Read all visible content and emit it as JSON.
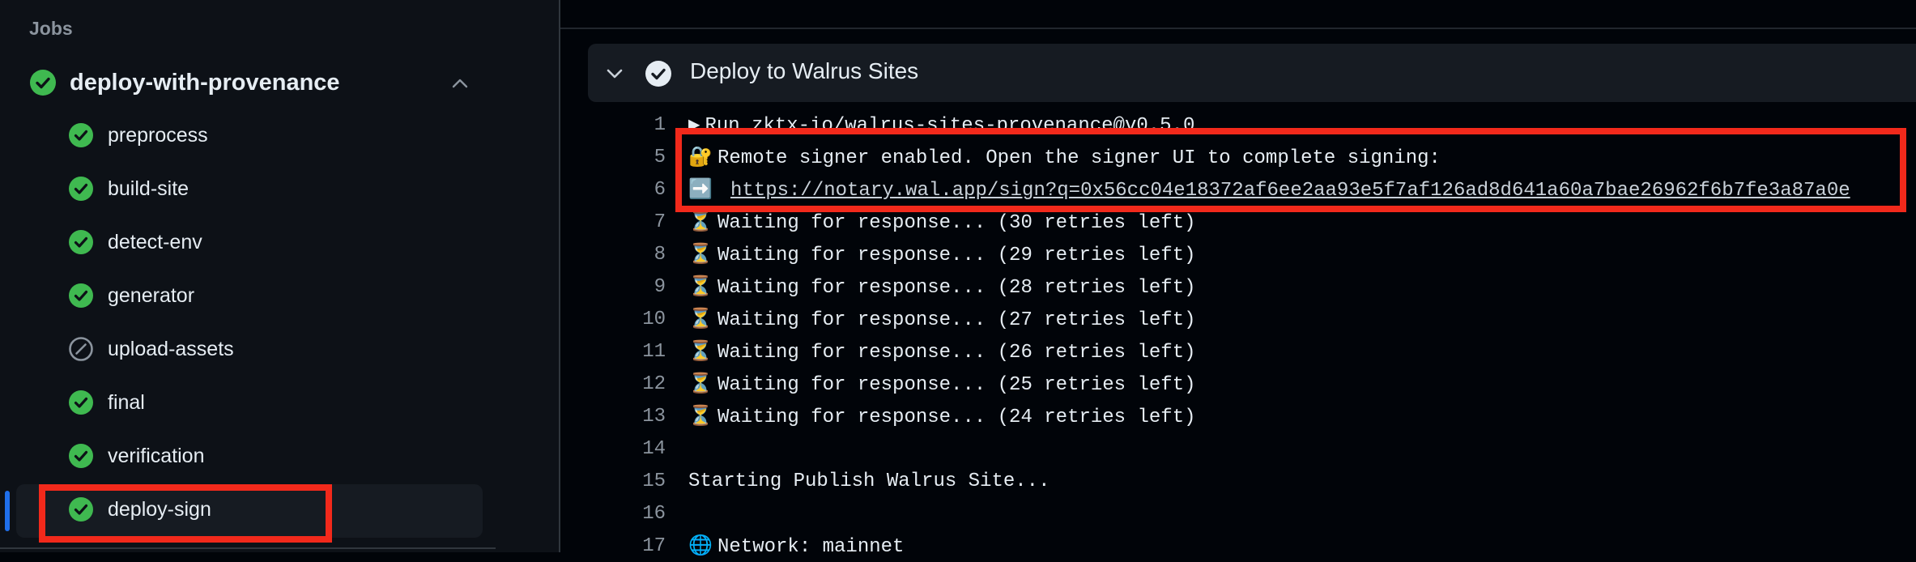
{
  "sidebar": {
    "title": "Jobs",
    "job": {
      "name": "deploy-with-provenance",
      "status": "success",
      "expanded": true
    },
    "steps": [
      {
        "label": "preprocess",
        "status": "success"
      },
      {
        "label": "build-site",
        "status": "success"
      },
      {
        "label": "detect-env",
        "status": "success"
      },
      {
        "label": "generator",
        "status": "success"
      },
      {
        "label": "upload-assets",
        "status": "skipped"
      },
      {
        "label": "final",
        "status": "success"
      },
      {
        "label": "verification",
        "status": "success"
      },
      {
        "label": "deploy-sign",
        "status": "success",
        "active": true
      }
    ]
  },
  "main": {
    "step_title": "Deploy to Walrus Sites",
    "log": [
      {
        "num": "1",
        "icon": "",
        "text": "Run zktx-io/walrus-sites-provenance@v0.5.0",
        "prefix": "▶"
      },
      {
        "num": "5",
        "icon": "🔐",
        "text": "Remote signer enabled. Open the signer UI to complete signing:"
      },
      {
        "num": "6",
        "icon": "➡️",
        "text": "https://notary.wal.app/sign?q=0x56cc04e18372af6ee2aa93e5f7af126ad8d641a60a7bae26962f6b7fe3a87a0e",
        "link": true
      },
      {
        "num": "7",
        "icon": "⏳",
        "text": "Waiting for response... (30 retries left)"
      },
      {
        "num": "8",
        "icon": "⏳",
        "text": "Waiting for response... (29 retries left)"
      },
      {
        "num": "9",
        "icon": "⏳",
        "text": "Waiting for response... (28 retries left)"
      },
      {
        "num": "10",
        "icon": "⏳",
        "text": "Waiting for response... (27 retries left)"
      },
      {
        "num": "11",
        "icon": "⏳",
        "text": "Waiting for response... (26 retries left)"
      },
      {
        "num": "12",
        "icon": "⏳",
        "text": "Waiting for response... (25 retries left)"
      },
      {
        "num": "13",
        "icon": "⏳",
        "text": "Waiting for response... (24 retries left)"
      },
      {
        "num": "14",
        "icon": "",
        "text": ""
      },
      {
        "num": "15",
        "icon": "",
        "text": "Starting Publish Walrus Site..."
      },
      {
        "num": "16",
        "icon": "",
        "text": ""
      },
      {
        "num": "17",
        "icon": "🌐",
        "text": "Network: mainnet"
      }
    ]
  },
  "colors": {
    "success": "#3fb950",
    "highlight": "#f2291b",
    "accent": "#1f6feb"
  }
}
